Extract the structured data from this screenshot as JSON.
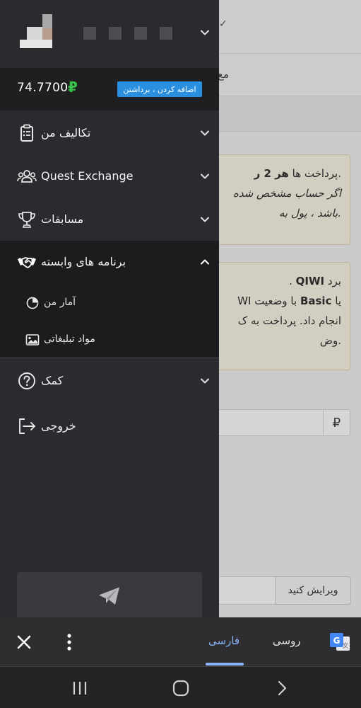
{
  "background": {
    "box1": {
      "line1_pre": ".پرداخت ها ",
      "line1_bold": "هر 2 ر",
      "line2": "اگر حساب مشخص شده",
      "line3": ".باشد ، پول به"
    },
    "box2": {
      "line1_pre": "برد ",
      "line1_bold": "QIWI",
      "line1_post": " .",
      "line2_pre": "یا ",
      "line2_bold": "Basic",
      "line2_post": " با وضعیت WI",
      "line3": "انجام داد. پرداخت به ک",
      "line4": ".وض"
    },
    "short_text": "مع",
    "currency_symbol": "₽",
    "edit_button": "ویرایش کنید"
  },
  "drawer": {
    "balance": "74.7700",
    "balance_currency": "₽",
    "add_withdraw_label": "اضافه کردن ، برداشتن",
    "menu": [
      {
        "label": "تکالیف من",
        "icon": "clipboard-icon"
      },
      {
        "label": "Quest Exchange",
        "icon": "users-group-icon"
      },
      {
        "label": "مسابقات",
        "icon": "trophy-icon"
      },
      {
        "label": "برنامه های وابسته",
        "icon": "handshake-icon"
      },
      {
        "label": "کمک",
        "icon": "question-circle-icon"
      },
      {
        "label": "خروجی",
        "icon": "logout-icon"
      }
    ],
    "submenu": [
      {
        "label": "آمار من",
        "icon": "pie-chart-icon"
      },
      {
        "label": "مواد تبلیغاتی",
        "icon": "image-icon"
      }
    ]
  },
  "translate_bar": {
    "target_lang": "فارسی",
    "source_lang": "روسی"
  },
  "colors": {
    "drawer_bg": "#2b2b2f",
    "accent_blue": "#2b8fe0",
    "ruble_green": "#39c24a",
    "translate_accent": "#8ab4f8"
  }
}
